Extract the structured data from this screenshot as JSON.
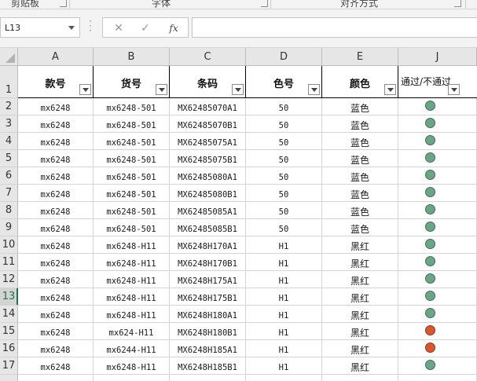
{
  "ribbon": {
    "groups": [
      {
        "label": "剪贴板"
      },
      {
        "label": "字体"
      },
      {
        "label": "对齐方式"
      }
    ]
  },
  "formula_bar": {
    "name_box": "L13",
    "cancel_icon": "close-icon",
    "enter_icon": "check-icon",
    "function_label": "fx",
    "formula_value": ""
  },
  "sheet": {
    "columns": [
      "A",
      "B",
      "C",
      "D",
      "E",
      "J"
    ],
    "header_row_number": "1",
    "headers": [
      "款号",
      "货号",
      "条码",
      "色号",
      "颜色",
      "通过/不通过"
    ],
    "active_row": "13",
    "status_colors": {
      "pass": "#6aa686",
      "fail": "#d9552f"
    },
    "rows": [
      {
        "num": "2",
        "style": "mx6248",
        "item": "mx6248-501",
        "barcode": "MX62485070A1",
        "color_no": "50",
        "color": "蓝色",
        "status": "pass"
      },
      {
        "num": "3",
        "style": "mx6248",
        "item": "mx6248-501",
        "barcode": "MX62485070B1",
        "color_no": "50",
        "color": "蓝色",
        "status": "pass"
      },
      {
        "num": "4",
        "style": "mx6248",
        "item": "mx6248-501",
        "barcode": "MX62485075A1",
        "color_no": "50",
        "color": "蓝色",
        "status": "pass"
      },
      {
        "num": "5",
        "style": "mx6248",
        "item": "mx6248-501",
        "barcode": "MX62485075B1",
        "color_no": "50",
        "color": "蓝色",
        "status": "pass"
      },
      {
        "num": "6",
        "style": "mx6248",
        "item": "mx6248-501",
        "barcode": "MX62485080A1",
        "color_no": "50",
        "color": "蓝色",
        "status": "pass"
      },
      {
        "num": "7",
        "style": "mx6248",
        "item": "mx6248-501",
        "barcode": "MX62485080B1",
        "color_no": "50",
        "color": "蓝色",
        "status": "pass"
      },
      {
        "num": "8",
        "style": "mx6248",
        "item": "mx6248-501",
        "barcode": "MX62485085A1",
        "color_no": "50",
        "color": "蓝色",
        "status": "pass"
      },
      {
        "num": "9",
        "style": "mx6248",
        "item": "mx6248-501",
        "barcode": "MX62485085B1",
        "color_no": "50",
        "color": "蓝色",
        "status": "pass"
      },
      {
        "num": "10",
        "style": "mx6248",
        "item": "mx6248-H11",
        "barcode": "MX6248H170A1",
        "color_no": "H1",
        "color": "黑红",
        "status": "pass"
      },
      {
        "num": "11",
        "style": "mx6248",
        "item": "mx6248-H11",
        "barcode": "MX6248H170B1",
        "color_no": "H1",
        "color": "黑红",
        "status": "pass"
      },
      {
        "num": "12",
        "style": "mx6248",
        "item": "mx6248-H11",
        "barcode": "MX6248H175A1",
        "color_no": "H1",
        "color": "黑红",
        "status": "pass"
      },
      {
        "num": "13",
        "style": "mx6248",
        "item": "mx6248-H11",
        "barcode": "MX6248H175B1",
        "color_no": "H1",
        "color": "黑红",
        "status": "pass"
      },
      {
        "num": "14",
        "style": "mx6248",
        "item": "mx6248-H11",
        "barcode": "MX6248H180A1",
        "color_no": "H1",
        "color": "黑红",
        "status": "pass"
      },
      {
        "num": "15",
        "style": "mx6248",
        "item": "mx624-H11",
        "barcode": "MX6248H180B1",
        "color_no": "H1",
        "color": "黑红",
        "status": "fail"
      },
      {
        "num": "16",
        "style": "mx6248",
        "item": "mx6244-H11",
        "barcode": "MX6248H185A1",
        "color_no": "H1",
        "color": "黑红",
        "status": "fail"
      },
      {
        "num": "17",
        "style": "mx6248",
        "item": "mx6248-H11",
        "barcode": "MX6248H185B1",
        "color_no": "H1",
        "color": "黑红",
        "status": "pass"
      }
    ]
  }
}
